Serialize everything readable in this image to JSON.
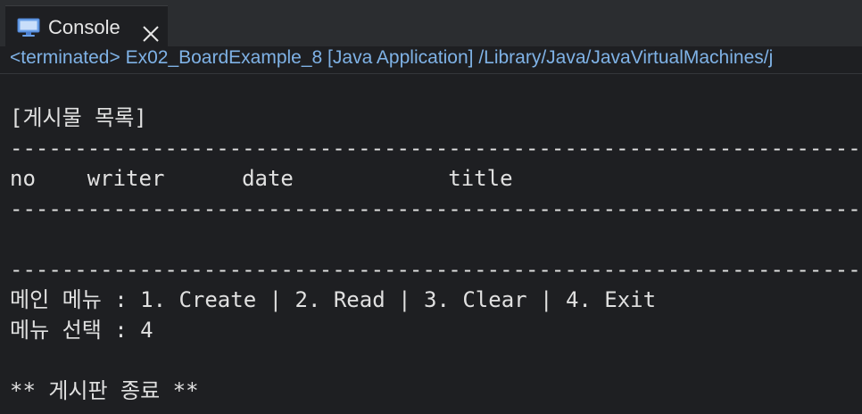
{
  "tab": {
    "icon": "monitor-icon",
    "label": "Console",
    "close_icon": "close-icon"
  },
  "status_line": "<terminated> Ex02_BoardExample_8 [Java Application] /Library/Java/JavaVirtualMachines/j",
  "console_lines": [
    "[게시물 목록]",
    "-----------------------------------------------------------------------------------",
    "no    writer      date            title",
    "-----------------------------------------------------------------------------------",
    "",
    "-----------------------------------------------------------------------------------",
    "메인 메뉴 : 1. Create | 2. Read | 3. Clear | 4. Exit",
    "메뉴 선택 : 4",
    "",
    "** 게시판 종료 **"
  ],
  "colors": {
    "background": "#1e1f22",
    "tabbar": "#2b2d30",
    "status_text": "#7fb2e6",
    "console_text": "#e0e0e0"
  }
}
